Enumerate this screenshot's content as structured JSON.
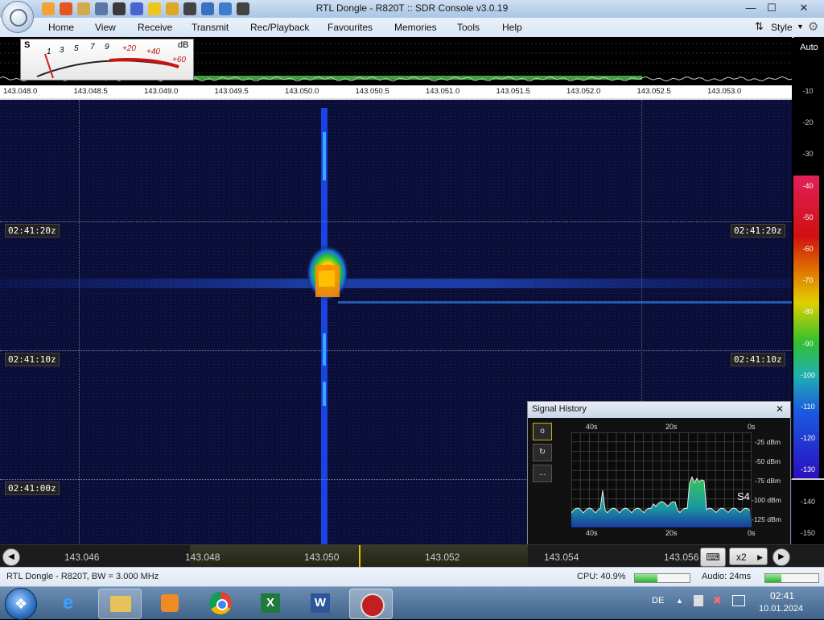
{
  "window": {
    "title": "RTL Dongle - R820T :: SDR Console v3.0.19",
    "minimize_glyph": "—",
    "maximize_glyph": "☐",
    "close_glyph": "✕"
  },
  "quick_access": [
    "home-icon",
    "help-circle-icon",
    "folder-icon",
    "play-icon",
    "stop-icon",
    "add-icon",
    "star-icon",
    "lock-icon",
    "camera-icon",
    "drop-icon",
    "refresh-icon",
    "dropdown-icon"
  ],
  "menu": {
    "items": [
      "Home",
      "View",
      "Receive",
      "Transmit",
      "Rec/Playback",
      "Favourites",
      "Memories",
      "Tools",
      "Help"
    ],
    "style_label": "Style"
  },
  "smeter": {
    "s_label": "S",
    "db_label": "dB",
    "scale": [
      "1",
      "3",
      "5",
      "7",
      "9",
      "+20",
      "+40",
      "+60"
    ]
  },
  "spectrum": {
    "auto_label": "Auto",
    "freq_axis": [
      "143.048.0",
      "143.048.5",
      "143.049.0",
      "143.049.5",
      "143.050.0",
      "143.050.5",
      "143.051.0",
      "143.051.5",
      "143.052.0",
      "143.052.5",
      "143.053.0"
    ]
  },
  "waterfall": {
    "time_marks": [
      "02:41:20z",
      "02:41:10z",
      "02:41:00z"
    ]
  },
  "db_scale": {
    "labels": [
      "-10",
      "-20",
      "-30",
      "-40",
      "-50",
      "-60",
      "-70",
      "-80",
      "-90",
      "-100",
      "-110",
      "-120",
      "-130",
      "-140",
      "-150"
    ]
  },
  "signal_history": {
    "title": "Signal History",
    "close_glyph": "✕",
    "top_axis": [
      "40s",
      "20s",
      "0s"
    ],
    "bottom_axis": [
      "40s",
      "20s",
      "0s"
    ],
    "db_axis": [
      "-25 dBm",
      "-50 dBm",
      "-75 dBm",
      "-100 dBm",
      "-125 dBm"
    ],
    "s_reading": "S4",
    "buttons": [
      "o",
      "↻",
      "..."
    ]
  },
  "tuning": {
    "labels": [
      "143.046",
      "143.048",
      "143.050",
      "143.052",
      "143.054",
      "143.056"
    ],
    "zoom_label": "x2"
  },
  "status": {
    "left_text": "RTL Dongle - R820T, BW = 3.000 MHz",
    "cpu_text": "CPU: 40.9%",
    "cpu_fraction": 0.409,
    "audio_text": "Audio: 24ms",
    "audio_fraction": 0.3
  },
  "taskbar": {
    "apps": [
      "internet-explorer-icon",
      "file-explorer-icon",
      "media-player-icon",
      "chrome-icon",
      "excel-icon",
      "word-icon",
      "sdr-console-icon"
    ],
    "language": "DE",
    "time": "02:41",
    "date": "10.01.2024"
  }
}
